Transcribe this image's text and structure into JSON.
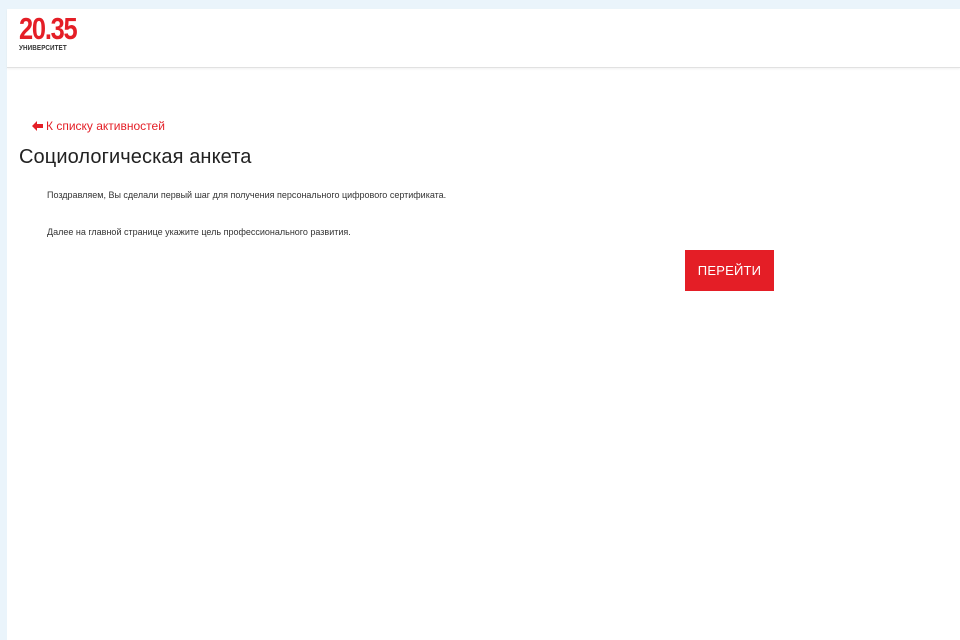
{
  "header": {
    "logo_number": "20.35",
    "logo_caption": "УНИВЕРСИТЕТ"
  },
  "navigation": {
    "back_label": "К списку активностей",
    "back_icon": "arrow-left-icon"
  },
  "main": {
    "title": "Социологическая анкета",
    "messages": [
      "Поздравляем, Вы сделали первый шаг для получения персонального цифрового сертификата.",
      "Далее на главной странице укажите цель профессионального развития."
    ],
    "button_label": "ПЕРЕЙТИ"
  },
  "colors": {
    "accent": "#e41e26",
    "page_background": "#eaf4fb",
    "content_background": "#ffffff",
    "text": "#222222"
  }
}
